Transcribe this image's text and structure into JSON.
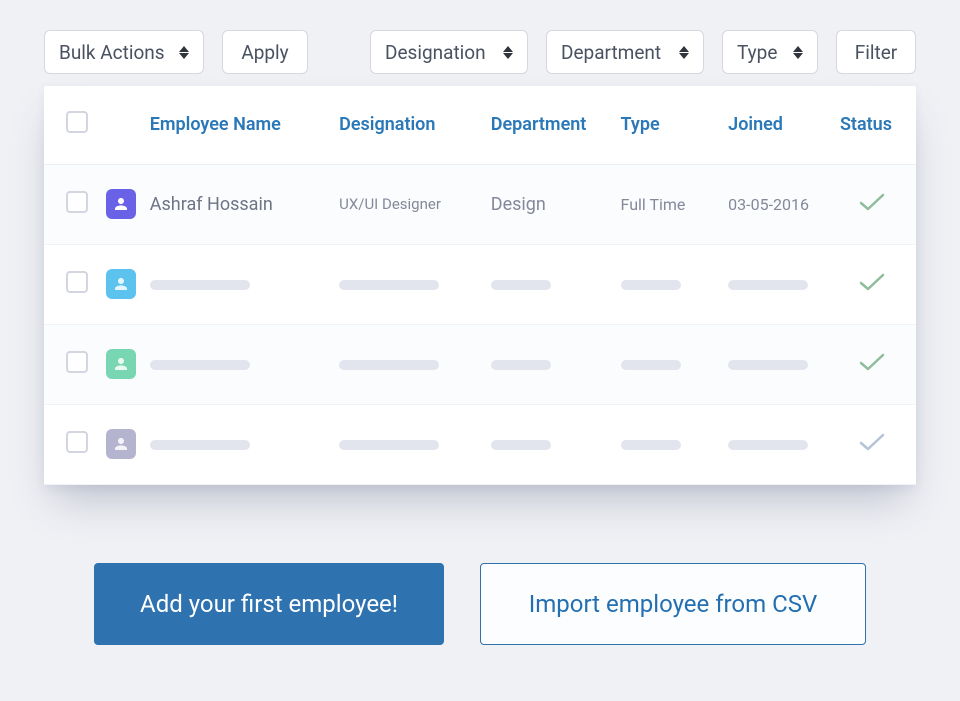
{
  "toolbar": {
    "bulk_actions_label": "Bulk Actions",
    "apply_label": "Apply",
    "designation_label": "Designation",
    "department_label": "Department",
    "type_label": "Type",
    "filter_label": "Filter"
  },
  "table": {
    "headers": {
      "name": "Employee Name",
      "designation": "Designation",
      "department": "Department",
      "type": "Type",
      "joined": "Joined",
      "status": "Status"
    },
    "rows": [
      {
        "avatar_color": "purple",
        "name": "Ashraf Hossain",
        "designation": "UX/UI Designer",
        "department": "Design",
        "type": "Full Time",
        "joined": "03-05-2016",
        "status": "active"
      },
      {
        "avatar_color": "blue",
        "placeholder": true,
        "status": "active"
      },
      {
        "avatar_color": "green",
        "placeholder": true,
        "status": "active"
      },
      {
        "avatar_color": "grey",
        "placeholder": true,
        "status": "inactive"
      }
    ]
  },
  "cta": {
    "primary": "Add your first employee!",
    "secondary": "Import employee from CSV"
  },
  "colors": {
    "brand_blue": "#2f72b0",
    "header_text": "#2a78b8"
  },
  "icons": {
    "sort": "up-down-chevron-icon",
    "avatar": "person-icon",
    "status_active": "check-icon"
  }
}
